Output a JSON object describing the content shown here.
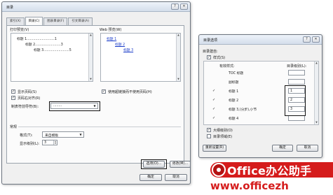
{
  "main_dialog": {
    "title": "目录",
    "tabs": [
      {
        "label": "索引(X)",
        "active": false
      },
      {
        "label": "目录(C)",
        "active": true
      },
      {
        "label": "图表目录(F)",
        "active": false
      },
      {
        "label": "引文目录(A)",
        "active": false
      }
    ],
    "print_preview": {
      "label": "打印预览(V)",
      "lines": [
        "标题 1..........................1",
        "标题 2........................3",
        "标题 3........................5"
      ]
    },
    "web_preview": {
      "label": "Web 预览(W)",
      "links": [
        "标题 1",
        "标题 2",
        "标题 3"
      ]
    },
    "show_page_numbers": {
      "label": "显示页码(S)",
      "checked": true
    },
    "right_align": {
      "label": "页码右对齐(R)",
      "checked": true
    },
    "tab_leader": {
      "label": "制表符前导符(B):",
      "value": "........"
    },
    "use_hyperlinks": {
      "label": "使用超链接而不使用页码(H)",
      "checked": true
    },
    "general": {
      "section_label": "常规",
      "formats_label": "格式(T):",
      "formats_value": "来自模板",
      "levels_label": "显示级别(L):",
      "levels_value": "3"
    },
    "buttons": {
      "options": "选项(O)...",
      "modify": "修改(M)...",
      "ok": "确定",
      "cancel": "取消"
    }
  },
  "options_dialog": {
    "title": "目录选项",
    "build_from_label": "目录建自:",
    "styles_checkbox": {
      "label": "样式(S)",
      "checked": true
    },
    "col_available": "有效样式:",
    "col_level": "目录级别(L):",
    "rows": [
      {
        "style": "TOC 标题",
        "level": "",
        "checked": false
      },
      {
        "style": "副标题",
        "level": "",
        "checked": false
      },
      {
        "style": "标题 1",
        "level": "1",
        "checked": true
      },
      {
        "style": "标题 2",
        "level": "2",
        "checked": true
      },
      {
        "style": "标题 3,(分步),小节",
        "level": "3",
        "checked": true
      },
      {
        "style": "标题 4",
        "level": "",
        "checked": true
      }
    ],
    "outline_levels": {
      "label": "大纲级别(O)",
      "checked": true
    },
    "entry_fields": {
      "label": "目录项域(E)",
      "checked": false
    },
    "buttons": {
      "reset": "重新设置(R)",
      "ok": "确定",
      "cancel": "取消"
    }
  },
  "watermark": {
    "title": "Office办公助手",
    "url": "www.officezh"
  }
}
